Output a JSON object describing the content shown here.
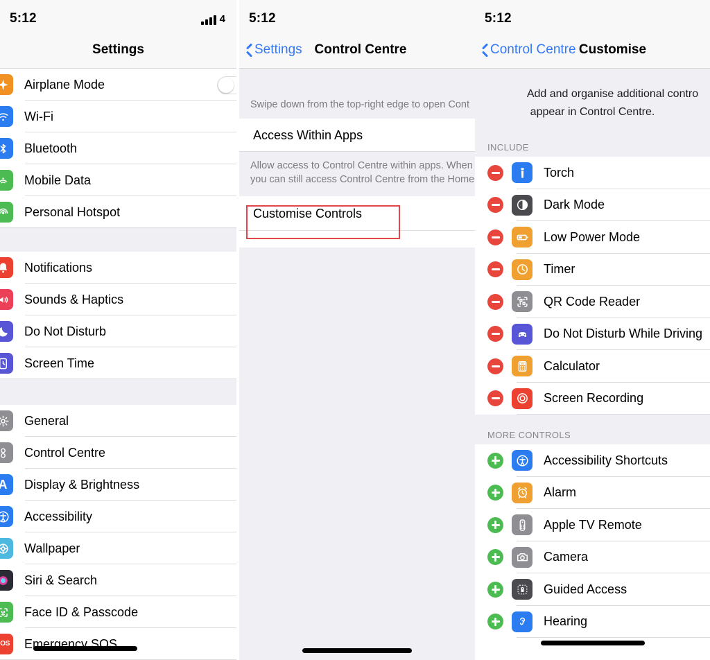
{
  "status": {
    "time": "5:12",
    "network": "4",
    "signal_bars": 4
  },
  "colors": {
    "accent_blue": "#3478f6",
    "minus_red": "#e8453c",
    "plus_green": "#4cbb52",
    "annotation_red": "#e0464b",
    "group_bg": "#efeff4"
  },
  "panel1": {
    "title": "Settings",
    "groups": [
      {
        "rows": [
          {
            "label": "Airplane Mode",
            "icon": "airplane-icon",
            "icon_color": "#f09121",
            "toggle": true
          },
          {
            "label": "Wi-Fi",
            "icon": "wifi-icon",
            "icon_color": "#2a7cf0",
            "toggle": false
          },
          {
            "label": "Bluetooth",
            "icon": "bluetooth-icon",
            "icon_color": "#2a7cf0",
            "toggle": false
          },
          {
            "label": "Mobile Data",
            "icon": "mobile-data-icon",
            "icon_color": "#4cbb52",
            "toggle": false
          },
          {
            "label": "Personal Hotspot",
            "icon": "hotspot-icon",
            "icon_color": "#4cbb52",
            "toggle": false
          }
        ]
      },
      {
        "rows": [
          {
            "label": "Notifications",
            "icon": "notifications-icon",
            "icon_color": "#ec4130",
            "toggle": false
          },
          {
            "label": "Sounds & Haptics",
            "icon": "sounds-icon",
            "icon_color": "#ec4058",
            "toggle": false
          },
          {
            "label": "Do Not Disturb",
            "icon": "do-not-disturb-icon",
            "icon_color": "#5856d6",
            "toggle": false
          },
          {
            "label": "Screen Time",
            "icon": "screen-time-icon",
            "icon_color": "#5856d6",
            "toggle": false
          }
        ]
      },
      {
        "rows": [
          {
            "label": "General",
            "icon": "gear-icon",
            "icon_color": "#8e8e93",
            "toggle": false
          },
          {
            "label": "Control Centre",
            "icon": "control-centre-icon",
            "icon_color": "#8e8e93",
            "toggle": false,
            "highlighted": true
          },
          {
            "label": "Display & Brightness",
            "icon": "display-brightness-icon",
            "icon_color": "#2a7cf0",
            "toggle": false
          },
          {
            "label": "Accessibility",
            "icon": "accessibility-icon",
            "icon_color": "#2a7cf0",
            "toggle": false
          },
          {
            "label": "Wallpaper",
            "icon": "wallpaper-icon",
            "icon_color": "#4db8e0",
            "toggle": false
          },
          {
            "label": "Siri & Search",
            "icon": "siri-icon",
            "icon_color": "#2b2b36",
            "toggle": false
          },
          {
            "label": "Face ID & Passcode",
            "icon": "face-id-icon",
            "icon_color": "#4cbb52",
            "toggle": false
          },
          {
            "label": "Emergency SOS",
            "icon": "emergency-sos-icon",
            "icon_color": "#ec4130",
            "toggle": false
          }
        ]
      }
    ]
  },
  "panel2": {
    "back_label": "Settings",
    "title": "Control Centre",
    "note_top": "Swipe down from the top-right edge to open Cont",
    "row_access": "Access Within Apps",
    "note_middle_line1": "Allow access to Control Centre within apps. When",
    "note_middle_line2": "you can still access Control Centre from the Home",
    "row_customise": "Customise Controls"
  },
  "panel3": {
    "back_label": "Control Centre",
    "title": "Customise",
    "desc_line1": "Add and organise additional contro",
    "desc_line2": "appear in Control Centre.",
    "include_header": "INCLUDE",
    "more_header": "MORE CONTROLS",
    "include": [
      {
        "label": "Torch",
        "icon": "torch-icon",
        "icon_color": "#2a7cf0",
        "action": "remove"
      },
      {
        "label": "Dark Mode",
        "icon": "dark-mode-icon",
        "icon_color": "#4a4a4f",
        "action": "remove"
      },
      {
        "label": "Low Power Mode",
        "icon": "low-power-mode-icon",
        "icon_color": "#f0a030",
        "action": "remove"
      },
      {
        "label": "Timer",
        "icon": "timer-icon",
        "icon_color": "#f0a030",
        "action": "remove"
      },
      {
        "label": "QR Code Reader",
        "icon": "qr-code-reader-icon",
        "icon_color": "#8e8e93",
        "action": "remove"
      },
      {
        "label": "Do Not Disturb While Driving",
        "icon": "driving-icon",
        "icon_color": "#5856d6",
        "action": "remove"
      },
      {
        "label": "Calculator",
        "icon": "calculator-icon",
        "icon_color": "#f0a030",
        "action": "remove"
      },
      {
        "label": "Screen Recording",
        "icon": "screen-recording-icon",
        "icon_color": "#ec4130",
        "action": "remove"
      }
    ],
    "more_controls": [
      {
        "label": "Accessibility Shortcuts",
        "icon": "accessibility-icon",
        "icon_color": "#2a7cf0",
        "action": "add"
      },
      {
        "label": "Alarm",
        "icon": "alarm-icon",
        "icon_color": "#f0a030",
        "action": "add"
      },
      {
        "label": "Apple TV Remote",
        "icon": "apple-tv-remote-icon",
        "icon_color": "#8e8e93",
        "action": "add"
      },
      {
        "label": "Camera",
        "icon": "camera-icon",
        "icon_color": "#8e8e93",
        "action": "add"
      },
      {
        "label": "Guided Access",
        "icon": "guided-access-icon",
        "icon_color": "#4a4a4f",
        "action": "add"
      },
      {
        "label": "Hearing",
        "icon": "hearing-icon",
        "icon_color": "#2a7cf0",
        "action": "add"
      }
    ]
  }
}
